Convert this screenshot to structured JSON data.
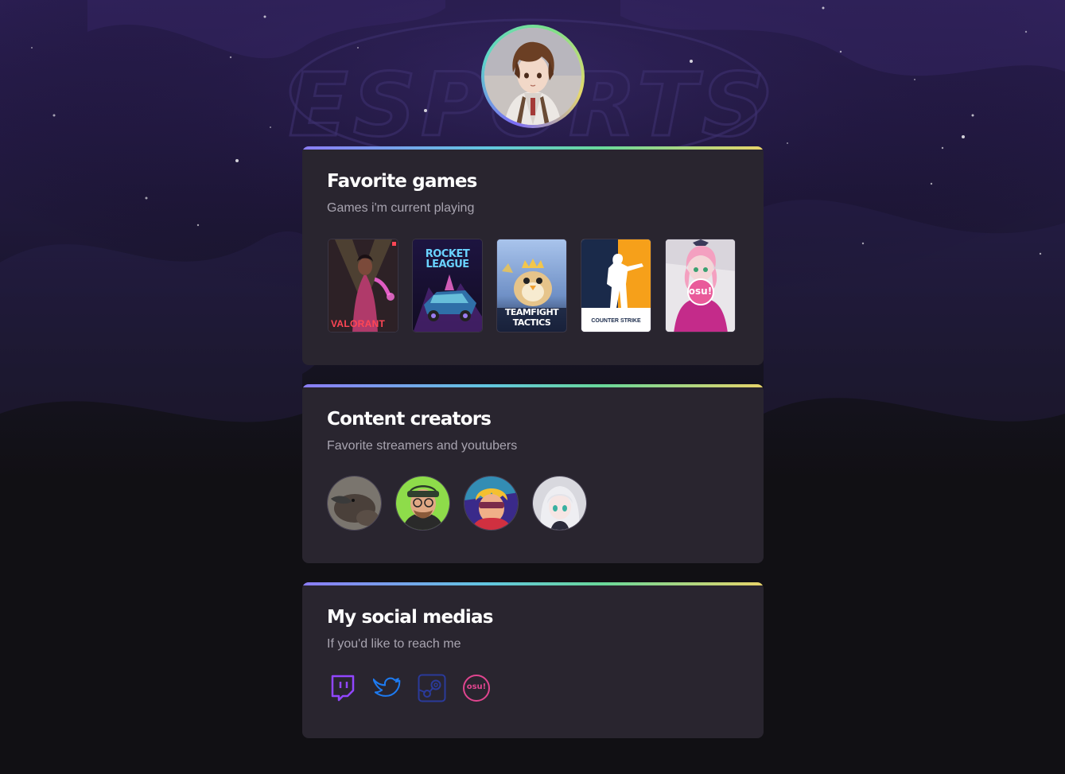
{
  "profile": {
    "avatar_icon": "profile-avatar-illustration"
  },
  "background": {
    "watermark_text": "ESPORTS"
  },
  "favorite_games": {
    "title": "Favorite games",
    "subtitle": "Games i'm current playing",
    "games": [
      {
        "name": "VALORANT",
        "color": "#ff4655"
      },
      {
        "name_line1": "ROCKET",
        "name_line2": "LEAGUE",
        "color": "#1b9ce6"
      },
      {
        "name_line1": "TEAMFIGHT",
        "name_line2": "TACTICS",
        "color": "#f3c64b"
      },
      {
        "name_line1": "COUNTER",
        "name_line2": "STRIKE",
        "color": "#f6a01a"
      },
      {
        "name": "osu!",
        "color": "#e0458f"
      }
    ]
  },
  "content_creators": {
    "title": "Content creators",
    "subtitle": "Favorite streamers and youtubers",
    "creators": [
      {
        "icon": "platypus-avatar"
      },
      {
        "icon": "bearded-man-avatar"
      },
      {
        "icon": "cartoon-hero-avatar"
      },
      {
        "icon": "anime-girl-avatar"
      }
    ]
  },
  "social_medias": {
    "title": "My social medias",
    "subtitle": "If you'd like to reach me",
    "links": [
      {
        "icon": "twitch-icon",
        "color": "#9146ff"
      },
      {
        "icon": "twitter-icon",
        "color": "#1d7bf2"
      },
      {
        "icon": "steam-icon",
        "color": "#2a3a9a"
      },
      {
        "icon": "osu-icon",
        "label": "osu!",
        "color": "#e0458f"
      }
    ]
  }
}
